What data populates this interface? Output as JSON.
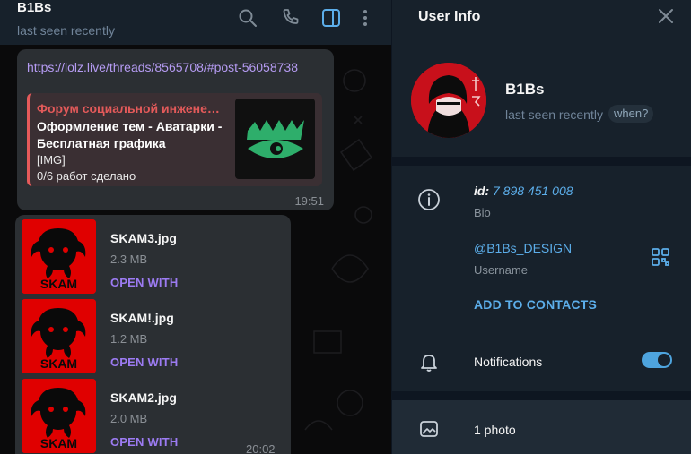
{
  "chat": {
    "title": "B1Bs",
    "status": "last seen recently",
    "header_icons": [
      "search-icon",
      "phone-icon",
      "sidebar-toggle-icon",
      "more-vertical-icon"
    ]
  },
  "link_message": {
    "url": "https://lolz.live/threads/8565708/#post-56058738",
    "preview": {
      "site": "Форум социальной инженерии",
      "title": "Оформление тем - Аватарки - Бесплатная графика",
      "desc_line1": "[IMG]",
      "desc_line2": "0/6 работ сделано"
    },
    "time": "19:51"
  },
  "files_message": {
    "files": [
      {
        "name": "SKAM3.jpg",
        "size": "2.3 MB",
        "action": "OPEN WITH",
        "thumb_text": "SKAM"
      },
      {
        "name": "SKAM!.jpg",
        "size": "1.2 MB",
        "action": "OPEN WITH",
        "thumb_text": "SKAM"
      },
      {
        "name": "SKAM2.jpg",
        "size": "2.0 MB",
        "action": "OPEN WITH",
        "thumb_text": "SKAM"
      }
    ],
    "time": "20:02"
  },
  "info": {
    "panel_title": "User Info",
    "name": "B1Bs",
    "status": "last seen recently",
    "when_badge": "when?",
    "id_label": "id:",
    "id_value": "7 898 451 008",
    "bio_label": "Bio",
    "username": "@B1Bs_DESIGN",
    "username_label": "Username",
    "add_contacts": "ADD TO CONTACTS",
    "notifications_label": "Notifications",
    "notifications_on": true,
    "photos_label": "1 photo"
  },
  "colors": {
    "accent_blue": "#5caeea",
    "link_purple": "#b59bf2",
    "preview_red": "#e45a5a",
    "panel_bg": "#17212b"
  }
}
